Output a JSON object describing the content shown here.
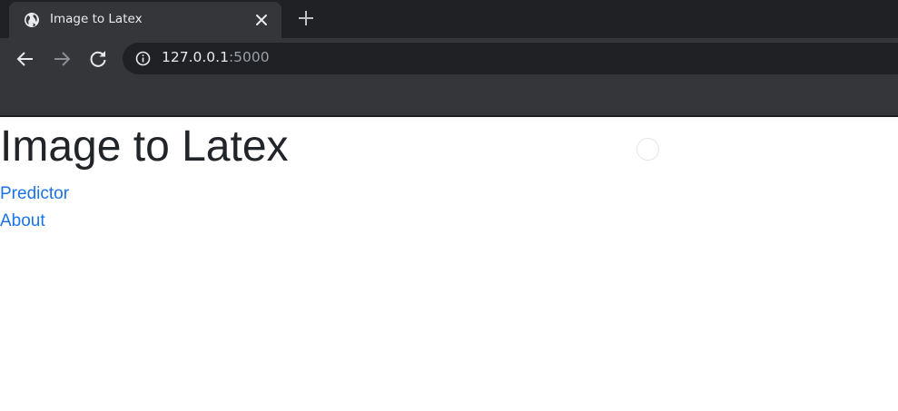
{
  "browser": {
    "tab": {
      "title": "Image to Latex",
      "favicon_icon": "globe-icon",
      "close_icon": "close-icon"
    },
    "new_tab_icon": "plus-icon",
    "nav": {
      "back_icon": "arrow-left-icon",
      "forward_icon": "arrow-right-icon",
      "reload_icon": "reload-icon"
    },
    "address_bar": {
      "info_icon": "info-icon",
      "host": "127.0.0.1",
      "port": ":5000"
    },
    "colors": {
      "tabstrip": "#202124",
      "toolbar": "#35363a",
      "omnibox": "#202124",
      "text": "#e8eaed",
      "muted": "#9aa0a6"
    }
  },
  "page": {
    "title": "Image to Latex",
    "links": [
      {
        "label": "Predictor"
      },
      {
        "label": "About"
      }
    ],
    "colors": {
      "title": "#212529",
      "link": "#1a73e8",
      "background": "#ffffff"
    }
  }
}
